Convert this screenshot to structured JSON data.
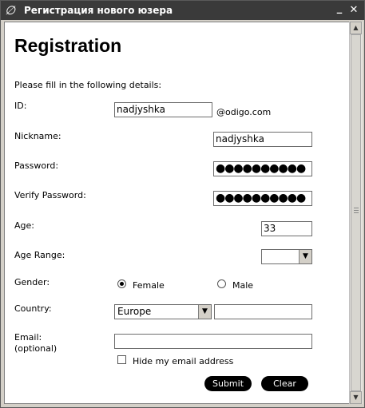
{
  "window": {
    "title": "Регистрация нового юзера",
    "app_icon": "∅",
    "minimize_glyph": "_",
    "close_glyph": "✕"
  },
  "form": {
    "heading": "Registration",
    "intro": "Please fill in the following details:",
    "id": {
      "label": "ID:",
      "value": "nadjyshka",
      "suffix": "@odigo.com"
    },
    "nickname": {
      "label": "Nickname:",
      "value": "nadjyshka"
    },
    "password": {
      "label": "Password:",
      "value": "●●●●●●●●●●"
    },
    "verify_password": {
      "label": "Verify Password:",
      "value": "●●●●●●●●●●"
    },
    "age": {
      "label": "Age:",
      "value": "33"
    },
    "age_range": {
      "label": "Age Range:",
      "value": ""
    },
    "gender": {
      "label": "Gender:",
      "female": "Female",
      "male": "Male",
      "selected": "Female"
    },
    "country": {
      "label": "Country:",
      "value": "Europe",
      "detail": ""
    },
    "email": {
      "label_line1": "Email:",
      "label_line2": "(optional)",
      "value": "",
      "hide_label": "Hide my email address",
      "hide_checked": false
    },
    "submit_label": "Submit",
    "clear_label": "Clear"
  },
  "icons": {
    "select_arrow": "▼",
    "scroll_up": "▲",
    "scroll_down": "▼"
  }
}
